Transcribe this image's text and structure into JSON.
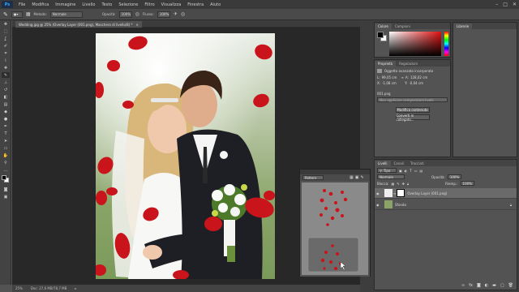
{
  "app": {
    "logo": "Ps",
    "menu": [
      "File",
      "Modifica",
      "Immagine",
      "Livello",
      "Testo",
      "Selezione",
      "Filtro",
      "Visualizza",
      "Finestra",
      "Aiuto"
    ],
    "window_controls": [
      "–",
      "□",
      "✕"
    ]
  },
  "options_bar": {
    "metodo_label": "Metodo:",
    "metodo_value": "Normale",
    "opacita_label": "Opacità:",
    "opacita_value": "100%",
    "flusso_label": "Flusso:",
    "flusso_value": "100%"
  },
  "document": {
    "tab_title": "Wedding.jpg @ 25% (Overlay Layer (001.png), Maschera di livello/8) *",
    "zoom": "25%",
    "doc_size": "Doc: 27,6 MB/78,7 MB"
  },
  "color_panel": {
    "tabs": [
      "Colore",
      "Campioni"
    ],
    "foreground": "#000000",
    "background": "#ffffff"
  },
  "library_panel": {
    "tab": "Librerie"
  },
  "properties_panel": {
    "tabs": [
      "Proprietà",
      "Regolazioni"
    ],
    "type_label": "Oggetto avanzato incorporato",
    "w_label": "L:",
    "w_value": "99,05 cm",
    "h_label": "A:",
    "h_value": "128,02 cm",
    "x_label": "X:",
    "x_value": "-1,08 cm",
    "y_label": "Y:",
    "y_value": "-0,04 cm",
    "file_name": "001.png",
    "comps_placeholder": "Non applicare composizioni livelli",
    "edit_button": "Modifica contenuto",
    "convert_button": "Converti in collegato..."
  },
  "layers_panel": {
    "tabs": [
      "Livelli",
      "Canali",
      "Tracciati"
    ],
    "filter": "Tipo",
    "blend_mode": "Normale",
    "opacity_label": "Opacità:",
    "opacity_value": "100%",
    "lock_label": "Blocca:",
    "fill_label": "Riemp.:",
    "fill_value": "100%",
    "layers": [
      {
        "name": "Overlay Layer (001.png)"
      },
      {
        "name": "Sfondo"
      }
    ]
  },
  "patterns_window": {
    "title": "Pattern"
  },
  "colors": {
    "petal": "#c8141a",
    "ui_dark": "#282828",
    "ui_mid": "#535353"
  }
}
